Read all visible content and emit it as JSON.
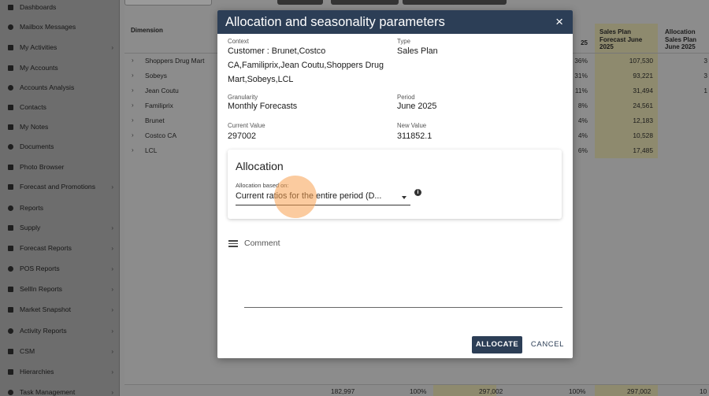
{
  "sidebar": {
    "items": [
      {
        "label": "Dashboards",
        "icon": "grid-icon",
        "chevron": false
      },
      {
        "label": "Mailbox Messages",
        "icon": "mail-icon",
        "chevron": false
      },
      {
        "label": "My Activities",
        "icon": "activity-icon",
        "chevron": true
      },
      {
        "label": "My Accounts",
        "icon": "accounts-icon",
        "chevron": false
      },
      {
        "label": "Accounts Analysis",
        "icon": "analysis-icon",
        "chevron": false
      },
      {
        "label": "Contacts",
        "icon": "contact-icon",
        "chevron": false
      },
      {
        "label": "My Notes",
        "icon": "notes-icon",
        "chevron": false
      },
      {
        "label": "Documents",
        "icon": "documents-icon",
        "chevron": false
      },
      {
        "label": "Photo Browser",
        "icon": "photo-icon",
        "chevron": false
      },
      {
        "label": "Forecast and Promotions",
        "icon": "chart-icon",
        "chevron": true
      },
      {
        "label": "Reports",
        "icon": "search-icon",
        "chevron": false
      },
      {
        "label": "Supply",
        "icon": "truck-icon",
        "chevron": true
      },
      {
        "label": "Forecast Reports",
        "icon": "forecast-icon",
        "chevron": true
      },
      {
        "label": "POS Reports",
        "icon": "dollar-icon",
        "chevron": true
      },
      {
        "label": "SellIn Reports",
        "icon": "dollar-icon",
        "chevron": true
      },
      {
        "label": "Market Snapshot",
        "icon": "market-icon",
        "chevron": true
      },
      {
        "label": "Activity Reports",
        "icon": "activity-report-icon",
        "chevron": true
      },
      {
        "label": "CSM",
        "icon": "csm-icon",
        "chevron": true
      },
      {
        "label": "Hierarchies",
        "icon": "hierarchy-icon",
        "chevron": true
      },
      {
        "label": "Task Management",
        "icon": "task-icon",
        "chevron": true
      }
    ]
  },
  "table": {
    "headers": {
      "dimension": "Dimension",
      "pct_col": "25",
      "sales_plan": "Sales Plan Forecast June 2025",
      "allocation": "Allocation Sales Plan June 2025"
    },
    "rows": [
      {
        "name": "Shoppers Drug Mart",
        "pct": "36%",
        "plan": "107,530",
        "alloc": "3"
      },
      {
        "name": "Sobeys",
        "pct": "31%",
        "plan": "93,221",
        "alloc": "3"
      },
      {
        "name": "Jean Coutu",
        "pct": "11%",
        "plan": "31,494",
        "alloc": "1"
      },
      {
        "name": "Familiprix",
        "pct": "8%",
        "plan": "24,561",
        "alloc": ""
      },
      {
        "name": "Brunet",
        "pct": "4%",
        "plan": "12,183",
        "alloc": ""
      },
      {
        "name": "Costco CA",
        "pct": "4%",
        "plan": "10,528",
        "alloc": ""
      },
      {
        "name": "LCL",
        "pct": "6%",
        "plan": "17,485",
        "alloc": ""
      }
    ],
    "footer": {
      "total1": "182,997",
      "pct1": "100%",
      "total2": "297,002",
      "pct2": "100%",
      "total3": "297,002",
      "alloc": "10"
    }
  },
  "modal": {
    "title": "Allocation and seasonality parameters",
    "close_icon": "×",
    "context_label": "Context",
    "context_value": "Customer : Brunet,Costco CA,Familiprix,Jean Coutu,Shoppers Drug Mart,Sobeys,LCL",
    "type_label": "Type",
    "type_value": "Sales Plan",
    "granularity_label": "Granularity",
    "granularity_value": "Monthly Forecasts",
    "period_label": "Period",
    "period_value": "June 2025",
    "current_label": "Current Value",
    "current_value": "297002",
    "new_label": "New Value",
    "new_value": "311852.1",
    "allocation": {
      "title": "Allocation",
      "select_label": "Allocation based on:",
      "select_value": "Current ratios for the entire period (D..."
    },
    "comment_label": "Comment",
    "comment_value": "",
    "allocate_button": "ALLOCATE",
    "cancel_button": "CANCEL",
    "accent_color": "#2c3e56"
  }
}
